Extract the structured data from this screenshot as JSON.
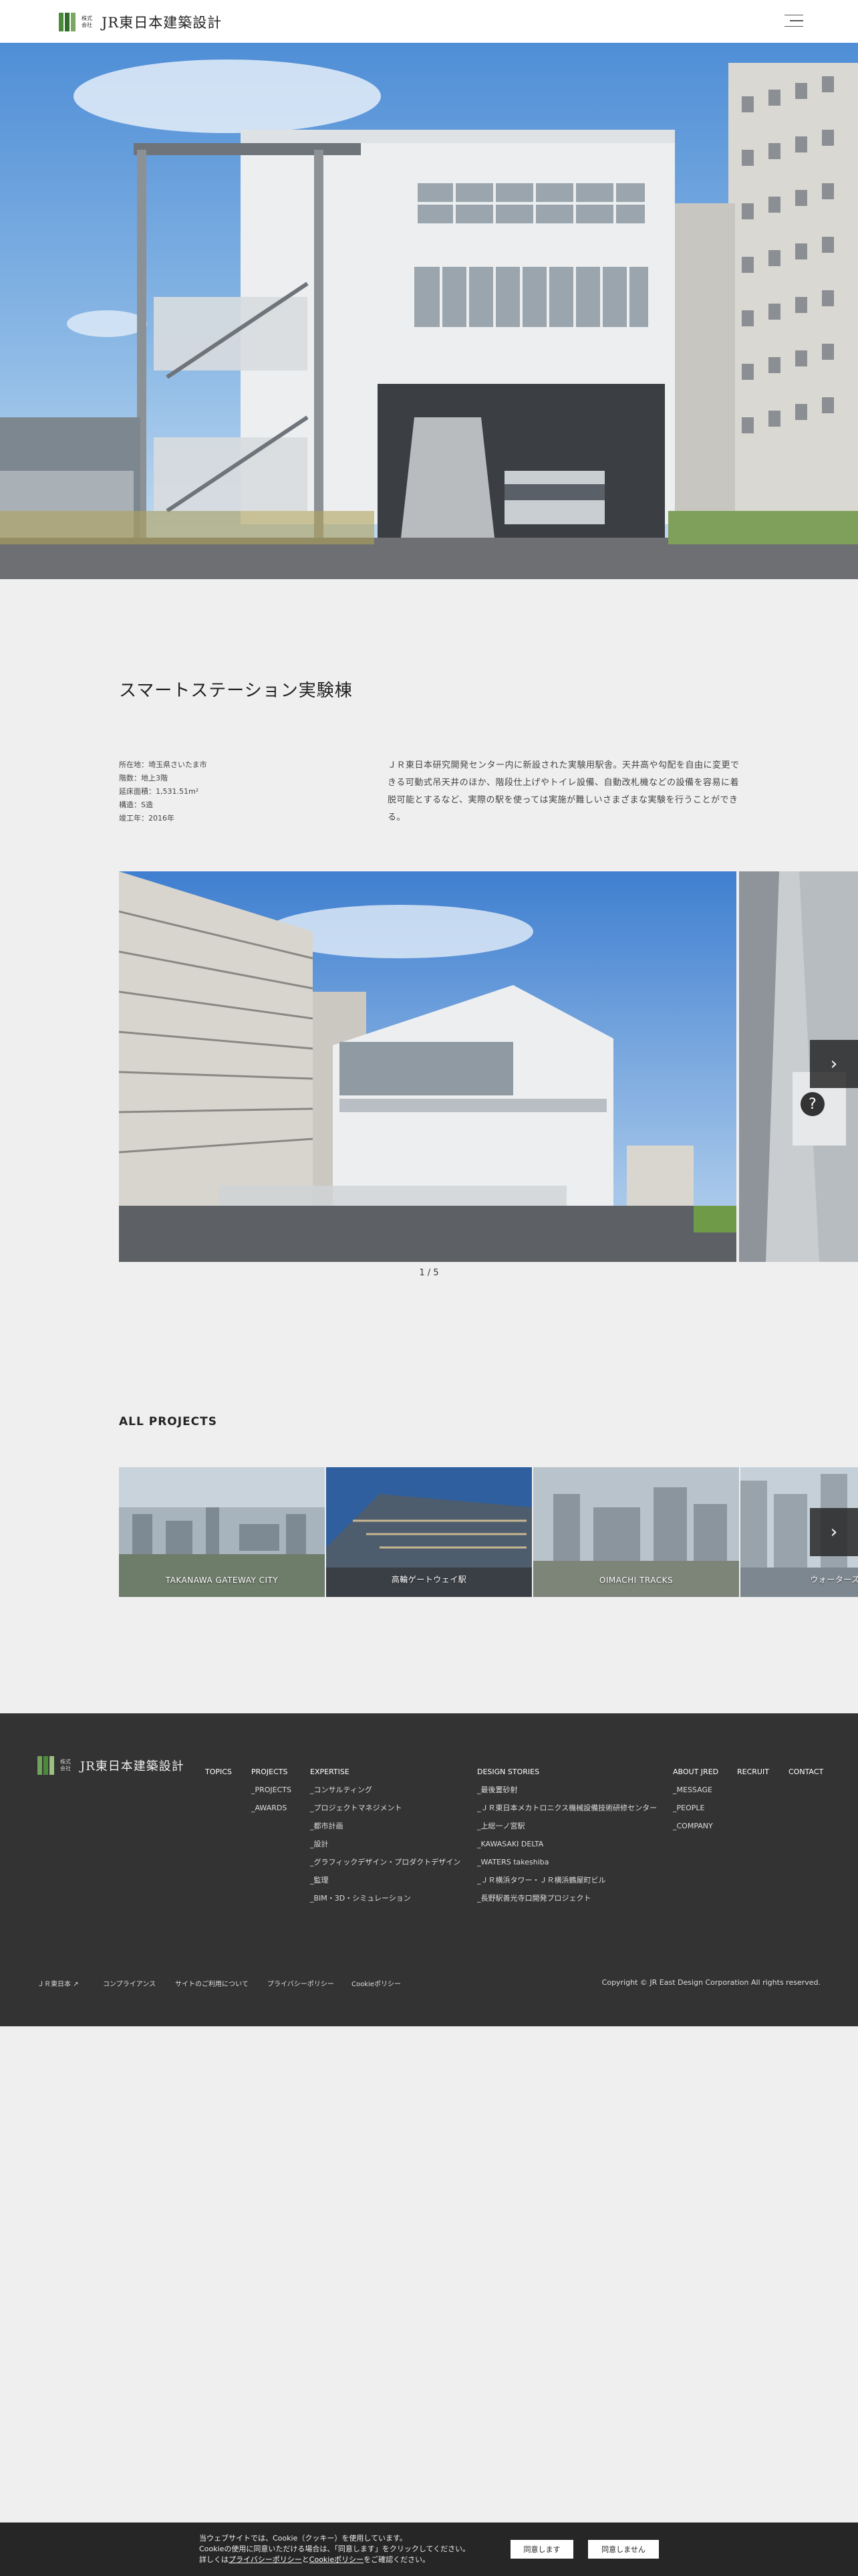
{
  "header": {
    "logo_small": "株式会社",
    "logo_text": "JR東日本建築設計"
  },
  "project": {
    "title": "スマートステーション実験棟",
    "specs": [
      "所在地：埼玉県さいたま市",
      "階数：地上3階",
      "延床面積：1,531.51m²",
      "構造：S造",
      "竣工年：2016年"
    ],
    "description": "ＪＲ東日本研究開発センター内に新設された実験用駅舎。天井高や勾配を自由に変更できる可動式吊天井のほか、階段仕上げやトイレ設備、自動改札機などの設備を容易に着脱可能とするなど、実際の駅を使っては実施が難しいさまざまな実験を行うことができる。"
  },
  "gallery": {
    "counter": "1 / 5",
    "next_label": "›"
  },
  "all_projects": {
    "title": "ALL PROJECTS",
    "next_label": "›",
    "cards": [
      {
        "label": "TAKANAWA GATEWAY CITY"
      },
      {
        "label": "高輪ゲートウェイ駅"
      },
      {
        "label": "OIMACHI TRACKS"
      },
      {
        "label": "ウォーターズ竹芝"
      }
    ]
  },
  "footer": {
    "logo_small": "株式会社",
    "logo_text": "JR東日本建築設計",
    "topics": "TOPICS",
    "projects_col": [
      "PROJECTS",
      "_PROJECTS",
      "_AWARDS"
    ],
    "expertise_col": [
      "EXPERTISE",
      "_コンサルティング",
      "_プロジェクトマネジメント",
      "_都市計画",
      "_設計",
      "_グラフィックデザイン・プロダクトデザイン",
      "_監理",
      "_BIM・3D・シミュレーション"
    ],
    "stories_col": [
      "DESIGN STORIES",
      "_最後置砂射",
      "_ＪＲ東日本メカトロニクス機械設備技術研修センター",
      "_上総一ノ宮駅",
      "_KAWASAKI DELTA",
      "_WATERS takeshiba",
      "_ＪＲ横浜タワー・ＪＲ横浜鶴屋町ビル",
      "_長野駅善光寺口開発プロジェクト"
    ],
    "about_col": [
      "ABOUT JRED",
      "_MESSAGE",
      "_PEOPLE",
      "_COMPANY"
    ],
    "recruit": "RECRUIT",
    "contact": "CONTACT",
    "bottom_links": [
      "ＪＲ東日本 ↗",
      "コンプライアンス",
      "サイトのご利用について",
      "プライバシーポリシー",
      "Cookieポリシー"
    ],
    "copyright": "Copyright © JR East Design Corporation All rights reserved."
  },
  "cookie": {
    "line1": "当ウェブサイトでは、Cookie（クッキー）を使用しています。",
    "line2": "Cookieの使用に同意いただける場合は、「同意します」をクリックしてください。",
    "line3_pre": "詳しくは",
    "privacy_link": "プライバシーポリシー",
    "and": "と",
    "cookie_link": "Cookieポリシー",
    "line3_post": "をご確認ください。",
    "accept": "同意します",
    "decline": "同意しません"
  },
  "colors": {
    "footer_bg": "#333333",
    "cookie_bg": "#262626",
    "page_bg": "#efefef",
    "logo_green": "#4a8a3a"
  }
}
